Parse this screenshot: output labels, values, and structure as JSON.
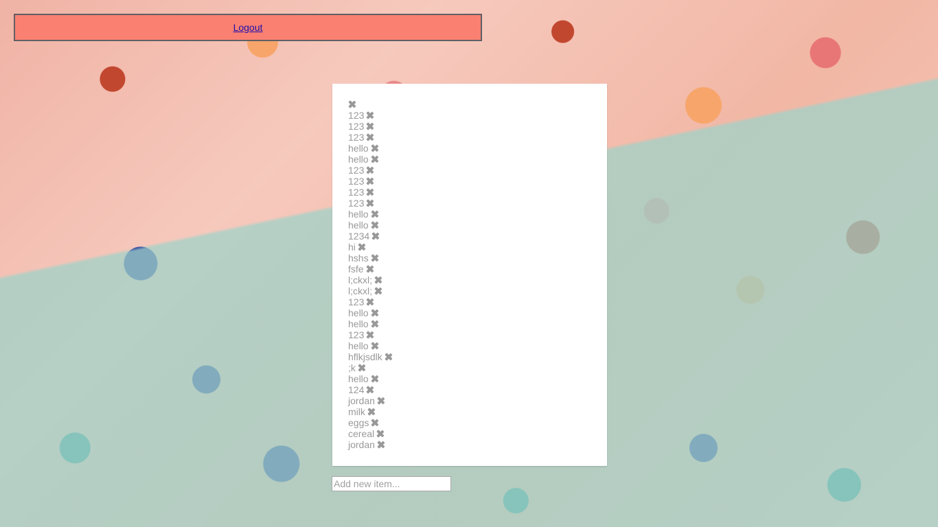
{
  "header": {
    "logout_label": "Logout"
  },
  "todo": {
    "items": [
      "",
      "123",
      "123",
      "123",
      "hello",
      "hello",
      "123",
      "123",
      "123",
      "123",
      "hello",
      "hello",
      "1234",
      "hi",
      "hshs",
      "fsfe",
      "l;ckxl;",
      "l;ckxl;",
      "123",
      "hello",
      "hello",
      "123",
      "hello",
      "hflkjsdlk",
      ";k",
      "hello",
      "124",
      "jordan",
      "milk",
      "eggs",
      "cereal",
      "jordan"
    ],
    "delete_icon": "close-icon"
  },
  "add_item": {
    "placeholder": "Add new item...",
    "value": ""
  },
  "colors": {
    "header_bg": "#fa8072",
    "header_border": "#5f6065",
    "item_text": "#999999",
    "link": "#1a0dab"
  }
}
